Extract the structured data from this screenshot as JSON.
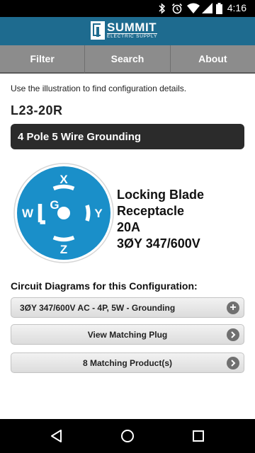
{
  "status_bar": {
    "time": "4:16",
    "icons": [
      "bluetooth-icon",
      "alarm-icon",
      "wifi-icon",
      "cell-signal-icon",
      "battery-icon"
    ]
  },
  "header": {
    "logo_name": "SUMMIT",
    "logo_sub": "ELECTRIC SUPPLY",
    "background_color": "#1e6b8f"
  },
  "nav": {
    "tabs": [
      {
        "label": "Filter"
      },
      {
        "label": "Search"
      },
      {
        "label": "About"
      }
    ]
  },
  "main": {
    "intro": "Use the illustration to find configuration details.",
    "config_code": "L23-20R",
    "config_type": "4 Pole 5 Wire Grounding",
    "receptacle": {
      "labels": {
        "top": "X",
        "left": "W",
        "right": "Y",
        "bottom": "Z",
        "center": "G"
      },
      "color": "#1a8fc9"
    },
    "specs": {
      "line1": "Locking Blade",
      "line2": "Receptacle",
      "line3": "20A",
      "line4": "3ØY 347/600V"
    },
    "section_title": "Circuit Diagrams for this Configuration:",
    "buttons": {
      "circuit": {
        "label": "3ØY 347/600V AC - 4P, 5W - Grounding",
        "icon": "plus-icon"
      },
      "plug": {
        "label": "View Matching Plug",
        "icon": "chevron-right-icon"
      },
      "products": {
        "label": "8 Matching Product(s)",
        "icon": "chevron-right-icon"
      }
    }
  }
}
